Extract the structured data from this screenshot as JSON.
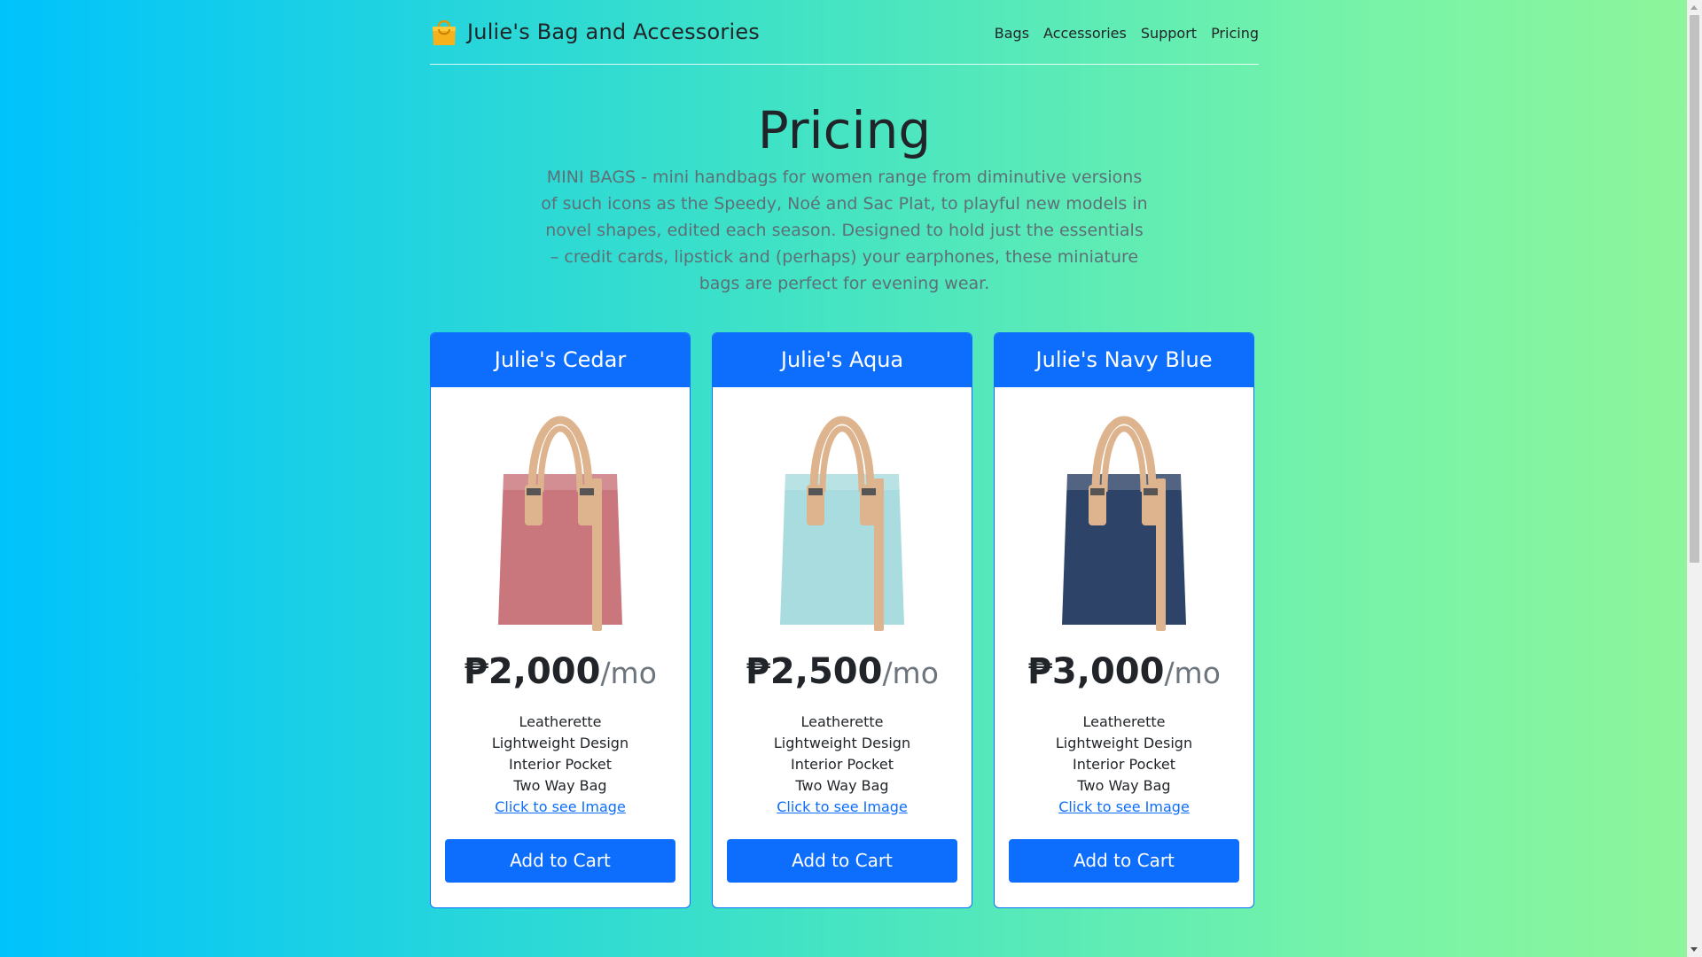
{
  "brand": {
    "name": "Julie's Bag and Accessories",
    "icon": "shopping-bag-icon"
  },
  "nav": {
    "items": [
      "Bags",
      "Accessories",
      "Support",
      "Pricing"
    ]
  },
  "hero": {
    "title": "Pricing",
    "description": "MINI BAGS - mini handbags for women range from diminutive versions of such icons as the Speedy, Noé and Sac Plat, to playful new models in novel shapes, edited each season. Designed to hold just the essentials – credit cards, lipstick and (perhaps) your earphones, these miniature bags are perfect for evening wear."
  },
  "cards": [
    {
      "title": "Julie's Cedar",
      "price": "₱2,000",
      "period": "/mo",
      "bag_color": "#c9767c",
      "features": [
        "Leatherette",
        "Lightweight Design",
        "Interior Pocket",
        "Two Way Bag"
      ],
      "link": "Click to see Image",
      "button": "Add to Cart"
    },
    {
      "title": "Julie's Aqua",
      "price": "₱2,500",
      "period": "/mo",
      "bag_color": "#a9dcdf",
      "features": [
        "Leatherette",
        "Lightweight Design",
        "Interior Pocket",
        "Two Way Bag"
      ],
      "link": "Click to see Image",
      "button": "Add to Cart"
    },
    {
      "title": "Julie's Navy Blue",
      "price": "₱3,000",
      "period": "/mo",
      "bag_color": "#2e4368",
      "features": [
        "Leatherette",
        "Lightweight Design",
        "Interior Pocket",
        "Two Way Bag"
      ],
      "link": "Click to see Image",
      "button": "Add to Cart"
    }
  ],
  "colors": {
    "primary": "#0d6efd",
    "strap": "#ddb48e",
    "gradient_start": "#00c3fc",
    "gradient_end": "#8ef59a"
  }
}
